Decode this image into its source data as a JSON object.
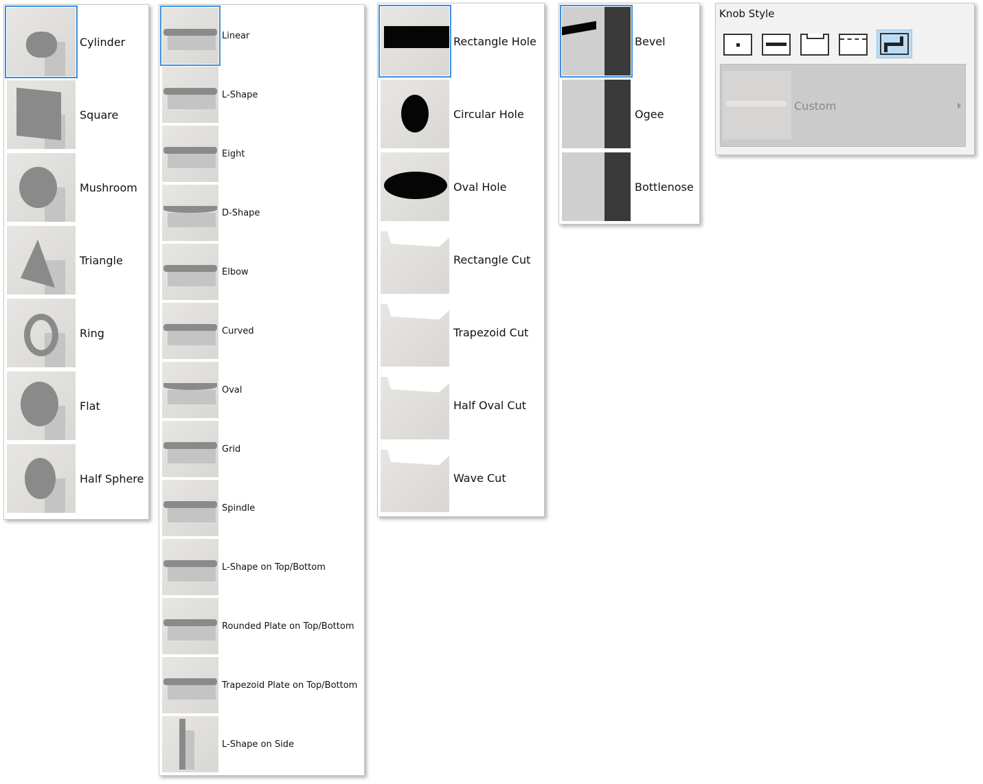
{
  "knob_shapes": {
    "items": [
      {
        "label": "Cylinder",
        "selected": true
      },
      {
        "label": "Square"
      },
      {
        "label": "Mushroom"
      },
      {
        "label": "Triangle"
      },
      {
        "label": "Ring"
      },
      {
        "label": "Flat"
      },
      {
        "label": "Half Sphere"
      }
    ]
  },
  "handle_shapes": {
    "items": [
      {
        "label": "Linear",
        "selected": true
      },
      {
        "label": "L-Shape"
      },
      {
        "label": "Eight"
      },
      {
        "label": "D-Shape"
      },
      {
        "label": "Elbow"
      },
      {
        "label": "Curved"
      },
      {
        "label": "Oval"
      },
      {
        "label": "Grid"
      },
      {
        "label": "Spindle"
      },
      {
        "label": "L-Shape on Top/Bottom"
      },
      {
        "label": "Rounded Plate on Top/Bottom"
      },
      {
        "label": "Trapezoid Plate on Top/Bottom"
      },
      {
        "label": "L-Shape on Side"
      }
    ]
  },
  "cut_shapes": {
    "items": [
      {
        "label": "Rectangle Hole",
        "selected": true
      },
      {
        "label": "Circular Hole"
      },
      {
        "label": "Oval Hole"
      },
      {
        "label": "Rectangle Cut"
      },
      {
        "label": "Trapezoid Cut"
      },
      {
        "label": "Half Oval Cut"
      },
      {
        "label": "Wave Cut"
      }
    ]
  },
  "edge_profiles": {
    "items": [
      {
        "label": "Bevel",
        "selected": true
      },
      {
        "label": "Ogee"
      },
      {
        "label": "Bottlenose"
      }
    ]
  },
  "knob_style": {
    "title": "Knob Style",
    "buttons": [
      "knob",
      "handle",
      "cut",
      "edge",
      "custom"
    ],
    "active_index": 4,
    "custom_label": "Custom"
  },
  "colors": {
    "selection": "#3b8fe0",
    "active_button": "#bcdcf5"
  }
}
